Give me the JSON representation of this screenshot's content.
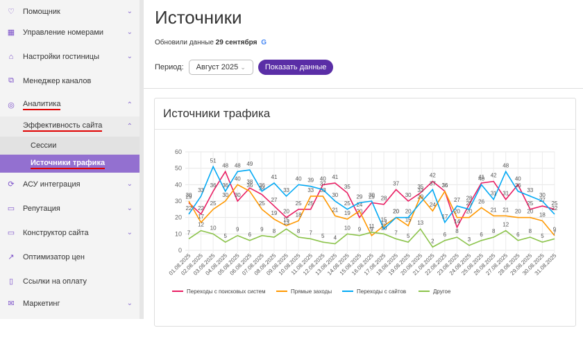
{
  "sidebar": {
    "items": [
      {
        "label": "Помощник",
        "icon": "heart-icon",
        "chev": "⌄"
      },
      {
        "label": "Управление номерами",
        "icon": "calendar-icon",
        "chev": "⌄"
      },
      {
        "label": "Настройки гостиницы",
        "icon": "home-icon",
        "chev": "⌄"
      },
      {
        "label": "Менеджер каналов",
        "icon": "hierarchy-icon",
        "chev": ""
      },
      {
        "label": "Аналитика",
        "icon": "analytics-icon",
        "chev": "⌃"
      },
      {
        "label": "Эффективность сайта",
        "icon": "",
        "chev": "⌃"
      },
      {
        "label": "Сессии",
        "icon": "",
        "chev": ""
      },
      {
        "label": "Источники трафика",
        "icon": "",
        "chev": ""
      },
      {
        "label": "АСУ интеграция",
        "icon": "integration-icon",
        "chev": "⌄"
      },
      {
        "label": "Репутация",
        "icon": "chat-icon",
        "chev": "⌄"
      },
      {
        "label": "Конструктор сайта",
        "icon": "monitor-icon",
        "chev": "⌄"
      },
      {
        "label": "Оптимизатор цен",
        "icon": "trend-icon",
        "chev": ""
      },
      {
        "label": "Ссылки на оплату",
        "icon": "clipboard-icon",
        "chev": ""
      },
      {
        "label": "Маркетинг",
        "icon": "mail-icon",
        "chev": "⌄"
      }
    ]
  },
  "page": {
    "title": "Источники",
    "updated_prefix": "Обновили данные ",
    "updated_date": "29 сентября",
    "google": "G",
    "period_label": "Период:",
    "period_value": "Август 2025",
    "period_chev": "⌄",
    "show_button": "Показать данные",
    "card_title": "Источники трафика"
  },
  "chart_data": {
    "type": "line",
    "title": "Источники трафика",
    "ylim": [
      0,
      60
    ],
    "yticks": [
      0,
      10,
      20,
      30,
      40,
      50,
      60
    ],
    "categories": [
      "01.08.2025",
      "02.08.2025",
      "03.08.2025",
      "04.08.2025",
      "05.08.2025",
      "06.08.2025",
      "07.08.2025",
      "08.08.2025",
      "09.08.2025",
      "10.08.2025",
      "11.08.2025",
      "12.08.2025",
      "13.08.2025",
      "14.08.2025",
      "15.08.2025",
      "16.08.2025",
      "17.08.2025",
      "18.08.2025",
      "19.08.2025",
      "20.08.2025",
      "21.08.2025",
      "22.08.2025",
      "23.08.2025",
      "24.08.2025",
      "25.08.2025",
      "26.08.2025",
      "27.08.2025",
      "28.08.2025",
      "29.08.2025",
      "30.08.2025",
      "31.08.2025"
    ],
    "legend_position": "bottom",
    "series": [
      {
        "name": "Переходы с поисковых систем",
        "color": "#e91e63",
        "values": [
          29,
          22,
          36,
          48,
          30,
          38,
          34,
          27,
          20,
          25,
          25,
          40,
          41,
          35,
          20,
          29,
          28,
          37,
          30,
          35,
          42,
          36,
          14,
          28,
          41,
          42,
          31,
          40,
          25,
          27,
          25
        ]
      },
      {
        "name": "Прямые заходы",
        "color": "#ff9800",
        "values": [
          30,
          17,
          25,
          30,
          40,
          36,
          25,
          19,
          15,
          18,
          33,
          33,
          21,
          19,
          24,
          9,
          15,
          20,
          15,
          33,
          24,
          36,
          20,
          20,
          26,
          21,
          21,
          20,
          20,
          18,
          9
        ]
      },
      {
        "name": "Переходы с сайтов",
        "color": "#03a9f4",
        "values": [
          22,
          33,
          51,
          36,
          48,
          49,
          36,
          41,
          33,
          40,
          39,
          37,
          30,
          25,
          29,
          30,
          13,
          20,
          20,
          29,
          37,
          17,
          27,
          25,
          40,
          31,
          48,
          36,
          33,
          30,
          22
        ]
      },
      {
        "name": "Другое",
        "color": "#8bc34a",
        "values": [
          7,
          12,
          10,
          5,
          9,
          6,
          9,
          8,
          13,
          8,
          7,
          5,
          4,
          10,
          9,
          11,
          10,
          7,
          5,
          13,
          2,
          6,
          8,
          3,
          6,
          8,
          12,
          6,
          8,
          5,
          7
        ]
      }
    ]
  }
}
